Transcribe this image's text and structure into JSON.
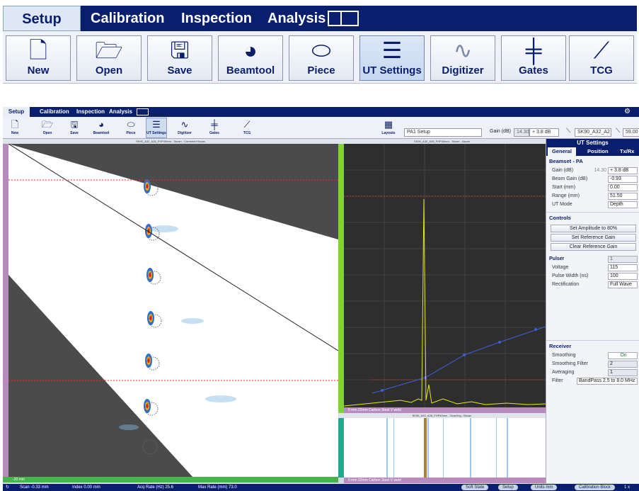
{
  "big_ribbon": {
    "tabs": [
      "Setup",
      "Calibration",
      "Inspection",
      "Analysis"
    ],
    "buttons": [
      {
        "label": "New",
        "icon": "new-file-icon"
      },
      {
        "label": "Open",
        "icon": "open-folder-icon"
      },
      {
        "label": "Save",
        "icon": "save-disk-icon"
      },
      {
        "label": "Beamtool",
        "icon": "beamtool-icon"
      },
      {
        "label": "Piece",
        "icon": "piece-icon"
      },
      {
        "label": "UT Settings",
        "icon": "ut-settings-icon"
      },
      {
        "label": "Digitizer",
        "icon": "digitizer-icon"
      },
      {
        "label": "Gates",
        "icon": "gates-icon"
      },
      {
        "label": "TCG",
        "icon": "tcg-icon"
      }
    ]
  },
  "app": {
    "tabs": [
      "Setup",
      "Calibration",
      "Inspection",
      "Analysis"
    ],
    "layouts_label": "Layouts",
    "setup_select": "PA1 Setup",
    "gain_label": "Gain (dB)",
    "gain_value": "14.30",
    "gain_offset": "+ 3.8 dB",
    "beamset_select": "SK90_A32_A2",
    "angle_value": "59.00",
    "sectorial_title": "SK90_A32_A28_FHP40mm - Sscan - Corrected Sscan",
    "ascan_title": "SK90_A32_A28_FHP40mm - Sscan - Ascan",
    "bscan_title": "SK90_A32_A28_FHP40mm - Scan/Ing - Bscan",
    "ascan_footer": "0 mm 22mm Carbon Steel V weld",
    "bscan_footer": "0 mm 22mm Carbon Steel V weld",
    "bscan_side": "0.000 Samples",
    "sector_bottom_left": "-20 mm"
  },
  "ut_panel": {
    "title": "UT Settings",
    "tabs": [
      "General",
      "Position",
      "Tx/Rx"
    ],
    "beamset_heading": "Beamset - PA",
    "rows": [
      {
        "label": "Gain (dB)",
        "grey": "14.30",
        "value": "+ 3.8 dB"
      },
      {
        "label": "Beam Gain (dB)",
        "value": "-0.93"
      },
      {
        "label": "Start (mm)",
        "value": "0.00"
      },
      {
        "label": "Range (mm)",
        "value": "51.50"
      },
      {
        "label": "UT Mode",
        "value": "Depth"
      }
    ],
    "controls_heading": "Controls",
    "control_buttons": [
      "Set Amplitude to 80%",
      "Set Reference Gain",
      "Clear Reference Gain"
    ],
    "pulser_heading": "Pulser",
    "pulser_value": "1",
    "pulser_rows": [
      {
        "label": "Voltage",
        "value": "115"
      },
      {
        "label": "Pulse Width (ns)",
        "value": "100"
      },
      {
        "label": "Rectification",
        "value": "Full Wave"
      }
    ],
    "receiver_heading": "Receiver",
    "receiver_rows": [
      {
        "label": "Smoothing",
        "value": "On"
      },
      {
        "label": "Smoothing Filter",
        "value": "2"
      },
      {
        "label": "Averaging",
        "value": "1"
      },
      {
        "label": "Filter",
        "value": "BandPass 2.5 to 8.0 MHz"
      }
    ]
  },
  "status": {
    "scan": "Scan  -0.33 mm",
    "index": "Index  0.00 mm",
    "acq_rate": "Acq Rate (Hz)  25.6",
    "max_rate": "Max Rate (mm)  73.0",
    "soft_state": "Soft State",
    "mode": "Setup",
    "units": "Units  mm",
    "calibration_block": "Calibration Block",
    "zoom": "1  x"
  },
  "colors": {
    "navy": "#0a1e6e",
    "ascan_trace": "#e3e81a",
    "gate_red": "#e03020",
    "tcg_blue": "#3a5fd9"
  }
}
